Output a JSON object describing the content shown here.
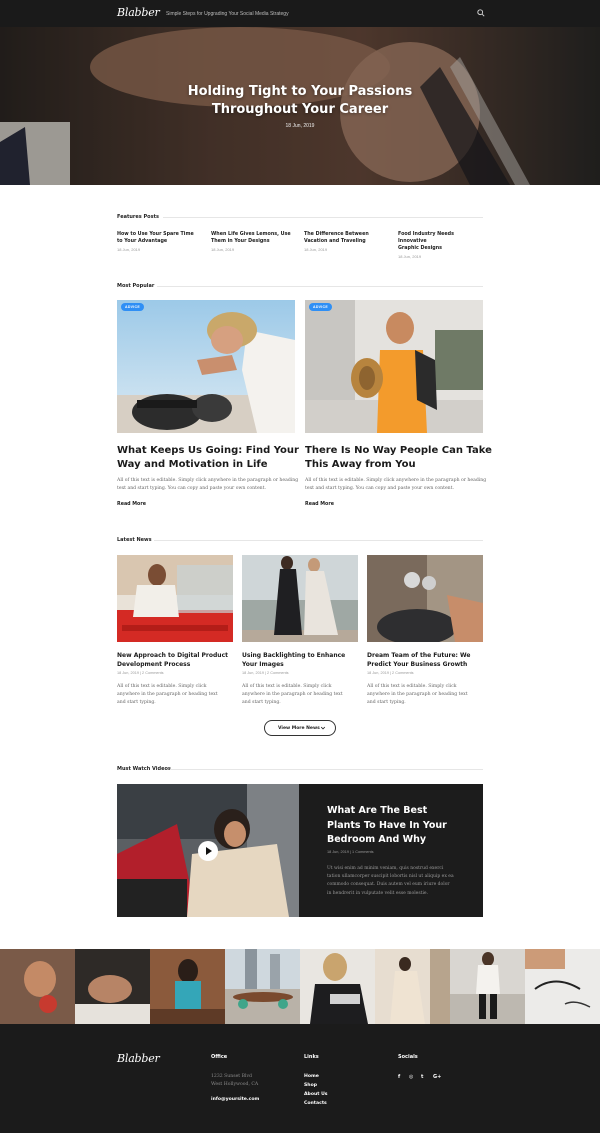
{
  "brand": {
    "logo": "Blabber",
    "tagline": "Simple Steps for Upgrading Your Social Media Strategy"
  },
  "icons": {
    "search": "search-icon",
    "play": "play-icon",
    "chevron": "chevron-down-icon"
  },
  "hero": {
    "title_lines": [
      "Holding Tight to Your Passions",
      "Throughout Your Career"
    ],
    "date": "18 Jun, 2019"
  },
  "features": {
    "heading": "Features Posts",
    "posts": [
      {
        "title_lines": [
          "How to Use Your Spare Time",
          "to Your Advantage"
        ],
        "date": "18 Jun, 2019"
      },
      {
        "title_lines": [
          "When Life Gives Lemons, Use",
          "Them in Your Designs"
        ],
        "date": "18 Jun, 2019"
      },
      {
        "title_lines": [
          "The Difference Between",
          "Vacation and Traveling"
        ],
        "date": "18 Jun, 2019"
      },
      {
        "title_lines": [
          "Food Industry Needs Innovative",
          "Graphic Designs"
        ],
        "date": "18 Jun, 2019"
      }
    ]
  },
  "popular": {
    "heading": "Most Popular",
    "items": [
      {
        "badge": "ADVICE",
        "title_lines": [
          "What Keeps Us Going: Find Your",
          "Way and Motivation in Life"
        ],
        "text_lines": [
          "All of this text is editable. Simply click anywhere in the paragraph or heading",
          "text and start typing. You can copy and paste your own content."
        ],
        "read_more": "Read More"
      },
      {
        "badge": "ADVICE",
        "title_lines": [
          "There Is No Way People Can Take",
          "This Away from You"
        ],
        "text_lines": [
          "All of this text is editable. Simply click anywhere in the paragraph or heading",
          "text and start typing. You can copy and paste your own content."
        ],
        "read_more": "Read More"
      }
    ]
  },
  "latest": {
    "heading": "Latest News",
    "items": [
      {
        "title_lines": [
          "New Approach to Digital Product",
          "Development Process"
        ],
        "meta": "18 Jun, 2019  |  2 Comments",
        "text_lines": [
          "All of this text is editable. Simply click",
          "anywhere in the paragraph or heading text",
          "and start typing."
        ]
      },
      {
        "title_lines": [
          "Using Backlighting to Enhance",
          "Your Images"
        ],
        "meta": "18 Jun, 2019  |  2 Comments",
        "text_lines": [
          "All of this text is editable. Simply click",
          "anywhere in the paragraph or heading text",
          "and start typing."
        ]
      },
      {
        "title_lines": [
          "Dream Team of the Future: We",
          "Predict Your Business Growth"
        ],
        "meta": "18 Jun, 2019  |  2 Comments",
        "text_lines": [
          "All of this text is editable. Simply click",
          "anywhere in the paragraph or heading text",
          "and start typing."
        ]
      }
    ],
    "more_button": "View More News"
  },
  "videos": {
    "heading": "Must Watch Videos",
    "title_lines": [
      "What Are The Best",
      "Plants To Have In Your",
      "Bedroom And Why"
    ],
    "meta": "18 Jun, 2019  |  1 Comments",
    "text_lines": [
      "Ut wisi enim ad minim veniam, quis nostrud exerci",
      "tation ullamcorper suscipit lobortis nisl ut aliquip ex ea",
      "commodo consequat. Duis autem vel eum iriure dolor",
      "in hendrerit in vulputate velit esse molestie."
    ]
  },
  "footer": {
    "logo": "Blabber",
    "office": {
      "heading": "Office",
      "address_lines": [
        "1232 Sunset Blvd",
        "West Hollywood, CA"
      ],
      "email": "info@yoursite.com"
    },
    "links": {
      "heading": "Links",
      "items": [
        "Home",
        "Shop",
        "About Us",
        "Contacts"
      ]
    },
    "socials": {
      "heading": "Socials",
      "items": [
        "f",
        "◎",
        "t",
        "G+"
      ]
    }
  }
}
